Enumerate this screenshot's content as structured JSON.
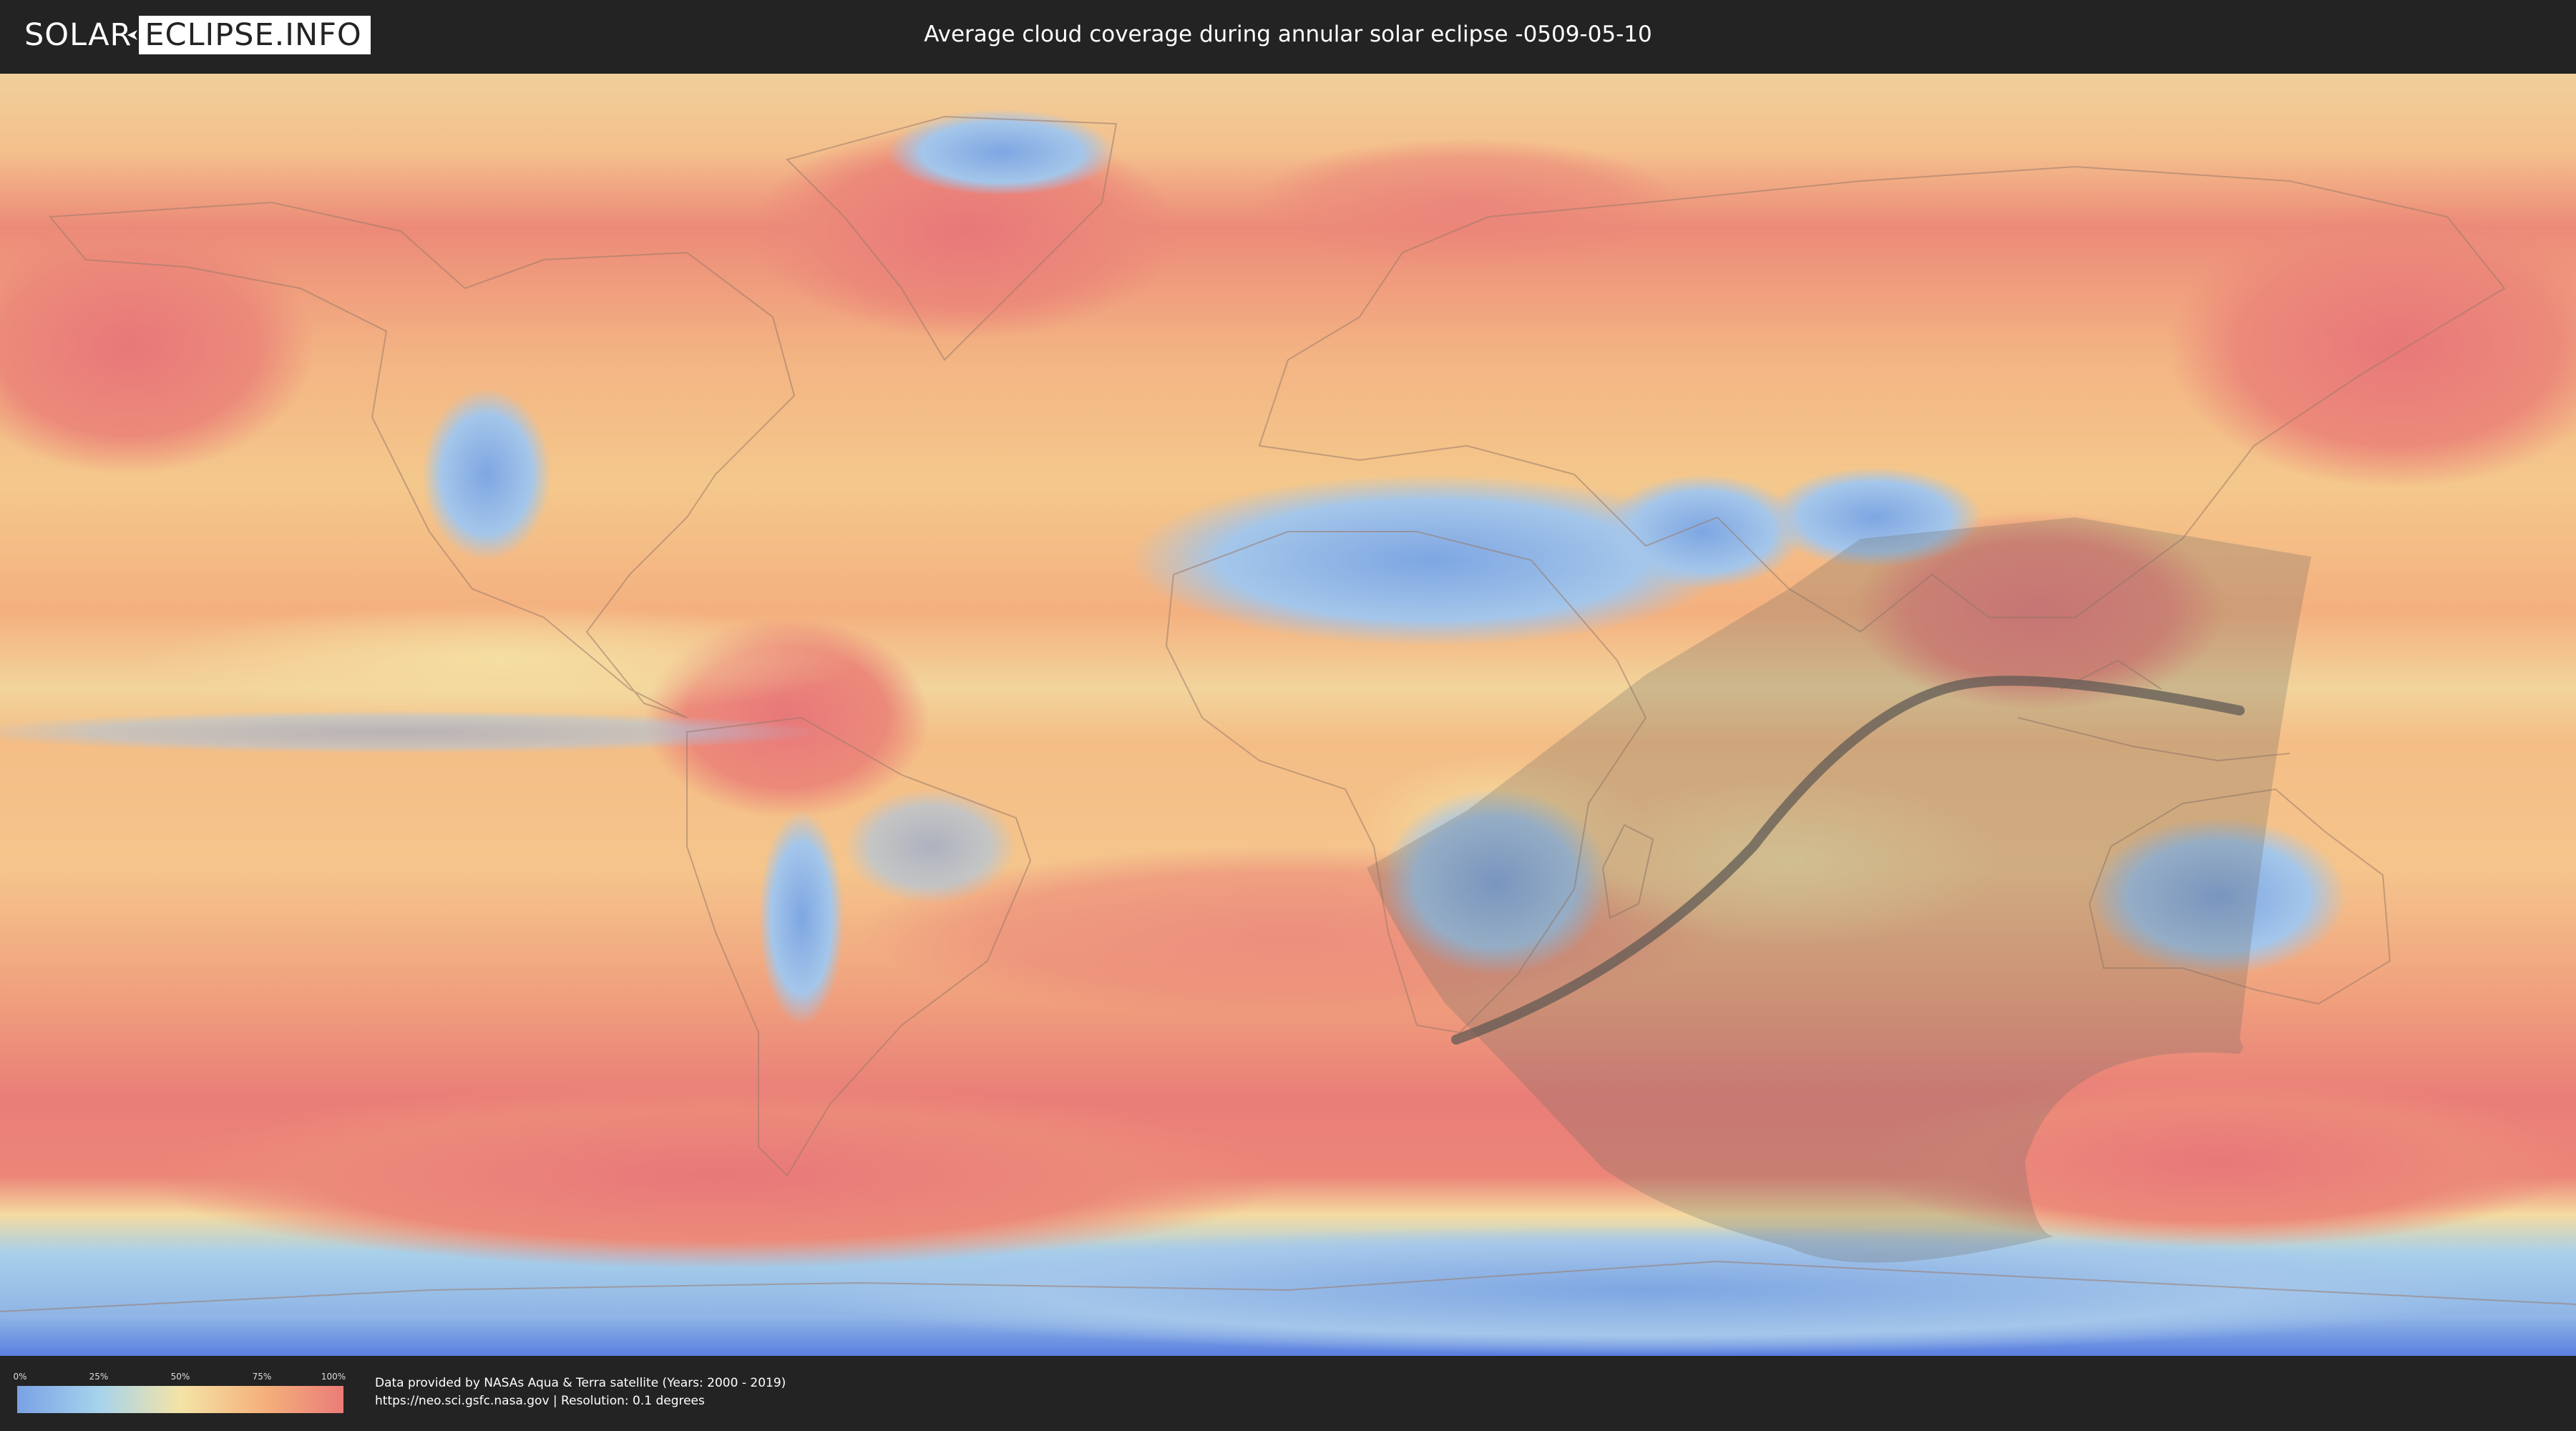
{
  "header": {
    "logo": {
      "part1": "SOLAR",
      "part2": "ECLIPSE.INFO"
    },
    "title": "Average cloud coverage during annular solar eclipse -0509-05-10"
  },
  "map": {
    "type": "world cloud coverage map",
    "palette": {
      "low": "#7aa1e4",
      "mid_low": "#a6d3ec",
      "mid": "#f4e3a6",
      "mid_high": "#f5b27c",
      "high": "#ea7c78"
    }
  },
  "legend": {
    "ticks": [
      "0%",
      "25%",
      "50%",
      "75%",
      "100%"
    ]
  },
  "footer": {
    "credit_line1": "Data provided by NASAs Aqua & Terra satellite (Years: 2000 - 2019)",
    "credit_line2": "https://neo.sci.gsfc.nasa.gov | Resolution: 0.1 degrees"
  }
}
